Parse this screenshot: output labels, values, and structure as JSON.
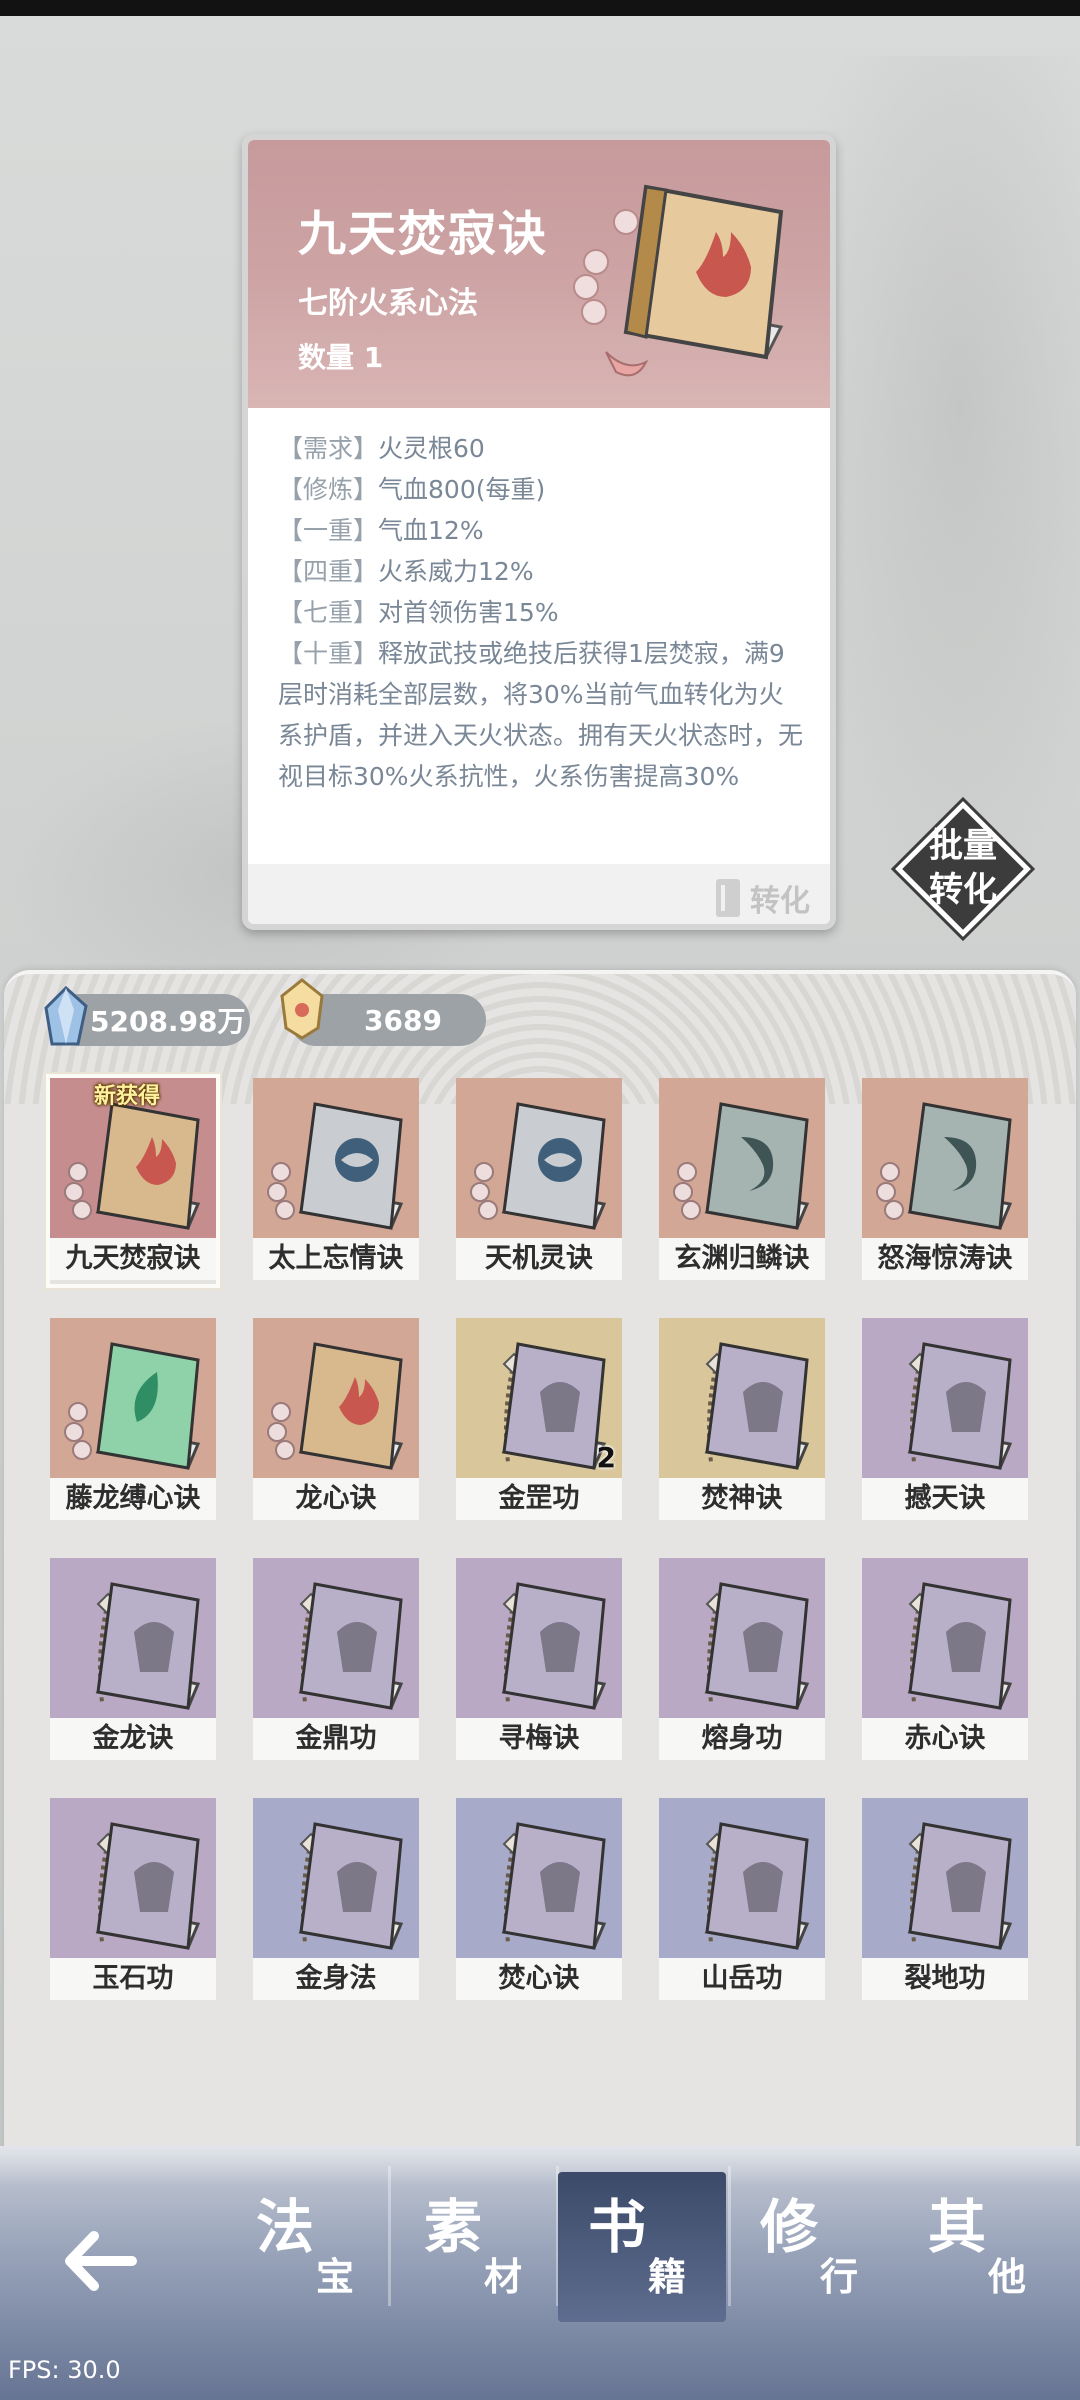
{
  "card": {
    "title": "九天焚寂诀",
    "subtitle": "七阶火系心法",
    "quantity": "数量 1",
    "lines": [
      {
        "tag": "【需求】",
        "text": "火灵根60"
      },
      {
        "tag": "【修炼】",
        "text": "气血800(每重)"
      },
      {
        "tag": "【一重】",
        "text": "气血12%"
      },
      {
        "tag": "【四重】",
        "text": "火系威力12%"
      },
      {
        "tag": "【七重】",
        "text": "对首领伤害15%"
      },
      {
        "tag": "【十重】",
        "text": "释放武技或绝技后获得1层焚寂，满9层时消耗全部层数，将30%当前气血转化为火系护盾，并进入天火状态。拥有天火状态时，无视目标30%火系抗性，火系伤害提高30%"
      }
    ],
    "convert_label": "转化"
  },
  "batch_button": {
    "line1": "批量",
    "line2": "转化"
  },
  "currency": {
    "spirit_stone": "5208.98万",
    "jade": "3689"
  },
  "items": [
    {
      "name": "九天焚寂诀",
      "badge": "新获得",
      "count": "",
      "bg": "#c68d8f",
      "cover": "#d8b98e",
      "emblem": "flame"
    },
    {
      "name": "太上忘情诀",
      "badge": "",
      "count": "",
      "bg": "#d3a796",
      "cover": "#c9cdd2",
      "emblem": "swirl"
    },
    {
      "name": "天机灵诀",
      "badge": "",
      "count": "",
      "bg": "#d3a796",
      "cover": "#c9cdd2",
      "emblem": "swirl"
    },
    {
      "name": "玄渊归鳞诀",
      "badge": "",
      "count": "",
      "bg": "#d3a796",
      "cover": "#a6b4b1",
      "emblem": "dragon"
    },
    {
      "name": "怒海惊涛诀",
      "badge": "",
      "count": "",
      "bg": "#d3a796",
      "cover": "#a6b4b1",
      "emblem": "dragon"
    },
    {
      "name": "藤龙缚心诀",
      "badge": "",
      "count": "",
      "bg": "#d3a796",
      "cover": "#8fd1a8",
      "emblem": "leaf"
    },
    {
      "name": "龙心诀",
      "badge": "",
      "count": "",
      "bg": "#d3a796",
      "cover": "#d8b98e",
      "emblem": "flame"
    },
    {
      "name": "金罡功",
      "badge": "",
      "count": "2",
      "bg": "#d9c79b",
      "cover": "#b8b0c9",
      "emblem": "seal"
    },
    {
      "name": "焚神诀",
      "badge": "",
      "count": "",
      "bg": "#d9c79b",
      "cover": "#b8b0c9",
      "emblem": "seal"
    },
    {
      "name": "撼天诀",
      "badge": "",
      "count": "",
      "bg": "#b9a9c4",
      "cover": "#b8b0c9",
      "emblem": "seal"
    },
    {
      "name": "金龙诀",
      "badge": "",
      "count": "",
      "bg": "#b9a9c4",
      "cover": "#b8b0c9",
      "emblem": "seal"
    },
    {
      "name": "金鼎功",
      "badge": "",
      "count": "",
      "bg": "#b9a9c4",
      "cover": "#b8b0c9",
      "emblem": "seal"
    },
    {
      "name": "寻梅诀",
      "badge": "",
      "count": "",
      "bg": "#b9a9c4",
      "cover": "#b8b0c9",
      "emblem": "seal"
    },
    {
      "name": "熔身功",
      "badge": "",
      "count": "",
      "bg": "#b9a9c4",
      "cover": "#b8b0c9",
      "emblem": "seal"
    },
    {
      "name": "赤心诀",
      "badge": "",
      "count": "",
      "bg": "#b9a9c4",
      "cover": "#b8b0c9",
      "emblem": "seal"
    },
    {
      "name": "玉石功",
      "badge": "",
      "count": "",
      "bg": "#b9a9c4",
      "cover": "#b8b0c9",
      "emblem": "seal"
    },
    {
      "name": "金身法",
      "badge": "",
      "count": "",
      "bg": "#a7aac9",
      "cover": "#b8b0c9",
      "emblem": "seal"
    },
    {
      "name": "焚心诀",
      "badge": "",
      "count": "",
      "bg": "#a7aac9",
      "cover": "#b8b0c9",
      "emblem": "seal"
    },
    {
      "name": "山岳功",
      "badge": "",
      "count": "",
      "bg": "#a7aac9",
      "cover": "#b8b0c9",
      "emblem": "seal"
    },
    {
      "name": "裂地功",
      "badge": "",
      "count": "",
      "bg": "#a7aac9",
      "cover": "#b8b0c9",
      "emblem": "seal"
    }
  ],
  "nav": {
    "tabs": [
      {
        "big": "法",
        "small": "宝",
        "active": false
      },
      {
        "big": "素",
        "small": "材",
        "active": false
      },
      {
        "big": "书",
        "small": "籍",
        "active": true
      },
      {
        "big": "修",
        "small": "行",
        "active": false
      },
      {
        "big": "其",
        "small": "他",
        "active": false
      }
    ]
  },
  "fps": "FPS: 30.0"
}
